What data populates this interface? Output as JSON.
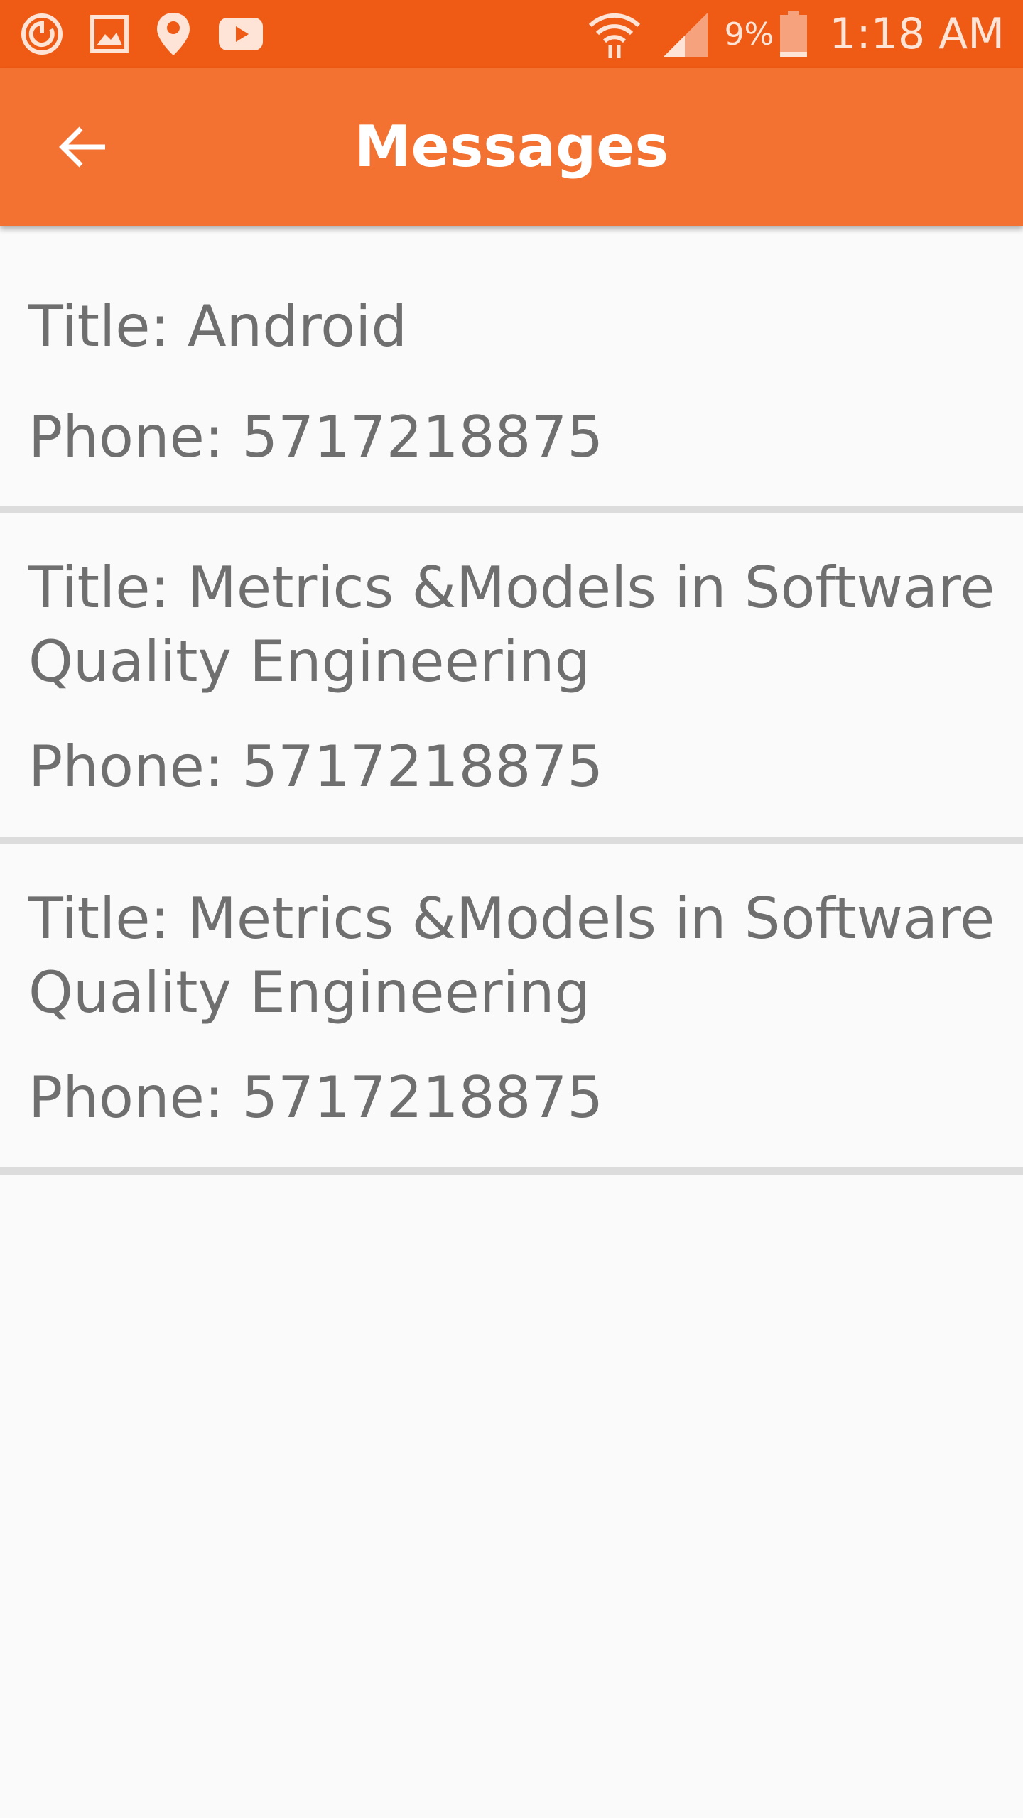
{
  "status_bar": {
    "left_icons": [
      "sync-icon",
      "gallery-icon",
      "location-pin-icon",
      "youtube-icon"
    ],
    "right_icons": [
      "wifi-icon",
      "cell-signal-icon",
      "battery-icon"
    ],
    "battery_percent": "9%",
    "time": "1:18 AM",
    "background_color": "#ef5a15"
  },
  "app_bar": {
    "back_icon": "arrow-left-icon",
    "title": "Messages",
    "background_color": "#f37232"
  },
  "messages": [
    {
      "title": "Title: Android",
      "phone": "Phone: 5717218875"
    },
    {
      "title": "Title: Metrics &Models in Software Quality Engineering",
      "phone": "Phone: 5717218875"
    },
    {
      "title": "Title: Metrics &Models in Software Quality Engineering",
      "phone": "Phone: 5717218875"
    }
  ]
}
